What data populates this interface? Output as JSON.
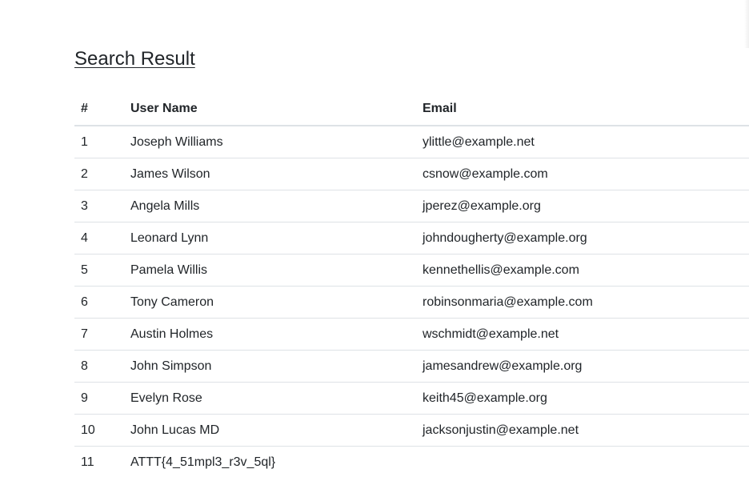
{
  "page": {
    "title": "Search Result"
  },
  "table": {
    "headers": {
      "num": "#",
      "username": "User Name",
      "email": "Email"
    },
    "rows": [
      {
        "num": "1",
        "username": "Joseph Williams",
        "email": "ylittle@example.net"
      },
      {
        "num": "2",
        "username": "James Wilson",
        "email": "csnow@example.com"
      },
      {
        "num": "3",
        "username": "Angela Mills",
        "email": "jperez@example.org"
      },
      {
        "num": "4",
        "username": "Leonard Lynn",
        "email": "johndougherty@example.org"
      },
      {
        "num": "5",
        "username": "Pamela Willis",
        "email": "kennethellis@example.com"
      },
      {
        "num": "6",
        "username": "Tony Cameron",
        "email": "robinsonmaria@example.com"
      },
      {
        "num": "7",
        "username": "Austin Holmes",
        "email": "wschmidt@example.net"
      },
      {
        "num": "8",
        "username": "John Simpson",
        "email": "jamesandrew@example.org"
      },
      {
        "num": "9",
        "username": "Evelyn Rose",
        "email": "keith45@example.org"
      },
      {
        "num": "10",
        "username": "John Lucas MD",
        "email": "jacksonjustin@example.net"
      },
      {
        "num": "11",
        "username": "ATTT{4_51mpl3_r3v_5ql}",
        "email": ""
      }
    ]
  }
}
